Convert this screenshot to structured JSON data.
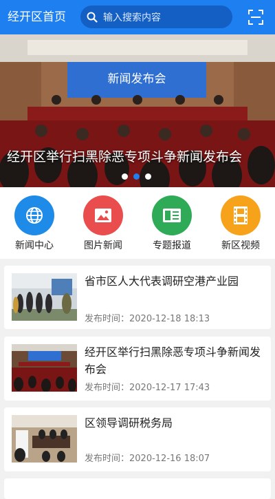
{
  "header": {
    "title": "经开区首页",
    "search_placeholder": "输入搜索内容",
    "scan_icon": "scan-icon"
  },
  "banner": {
    "caption": "经开区举行扫黑除恶专项斗争新闻发布会",
    "screen_text": "新闻发布会",
    "dots": 3,
    "active_dot": 1
  },
  "quicknav": [
    {
      "label": "新闻中心",
      "icon": "globe-icon",
      "color": "#1e8be8"
    },
    {
      "label": "图片新闻",
      "icon": "image-icon",
      "color": "#ea4d4d"
    },
    {
      "label": "专题报道",
      "icon": "book-icon",
      "color": "#2faa57"
    },
    {
      "label": "新区视频",
      "icon": "film-icon",
      "color": "#f7a21b"
    }
  ],
  "news": [
    {
      "title": "省市区人大代表调研空港产业园",
      "time_label": "发布时间：",
      "time": "2020-12-18 18:13"
    },
    {
      "title": "经开区举行扫黑除恶专项斗争新闻发布会",
      "time_label": "发布时间：",
      "time": "2020-12-17 17:43"
    },
    {
      "title": "区领导调研税务局",
      "time_label": "发布时间：",
      "time": "2020-12-16 18:07"
    }
  ],
  "colors": {
    "primary": "#1e7ff0",
    "search_bg": "#135fc4",
    "page_bg": "#f1f1f1"
  }
}
